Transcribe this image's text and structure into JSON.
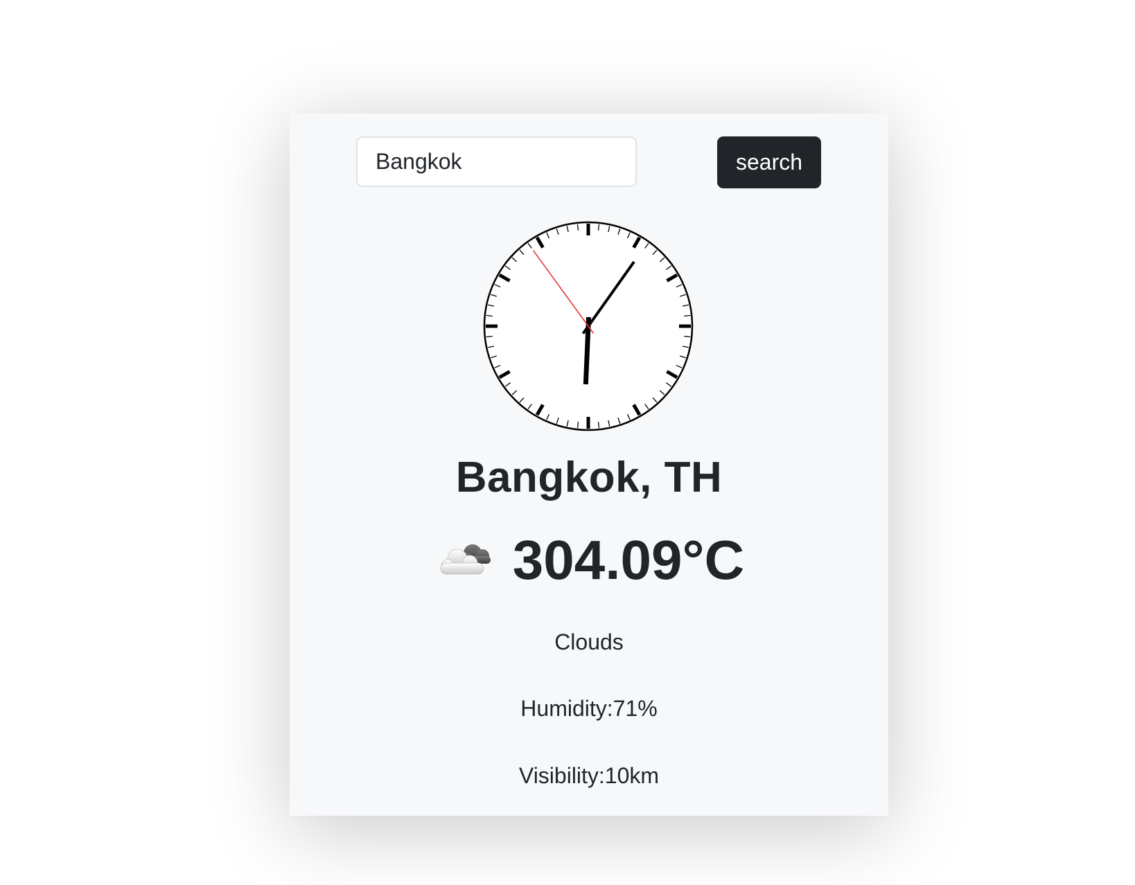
{
  "search": {
    "value": "Bangkok",
    "button_label": "search"
  },
  "clock": {
    "hour": 6,
    "minute": 5,
    "second": 54,
    "second_hand_color": "#e53935"
  },
  "weather": {
    "location": "Bangkok, TH",
    "icon": "cloud-icon",
    "temperature": "304.09°C",
    "condition": "Clouds",
    "humidity": "Humidity:71%",
    "visibility": "Visibility:10km"
  }
}
